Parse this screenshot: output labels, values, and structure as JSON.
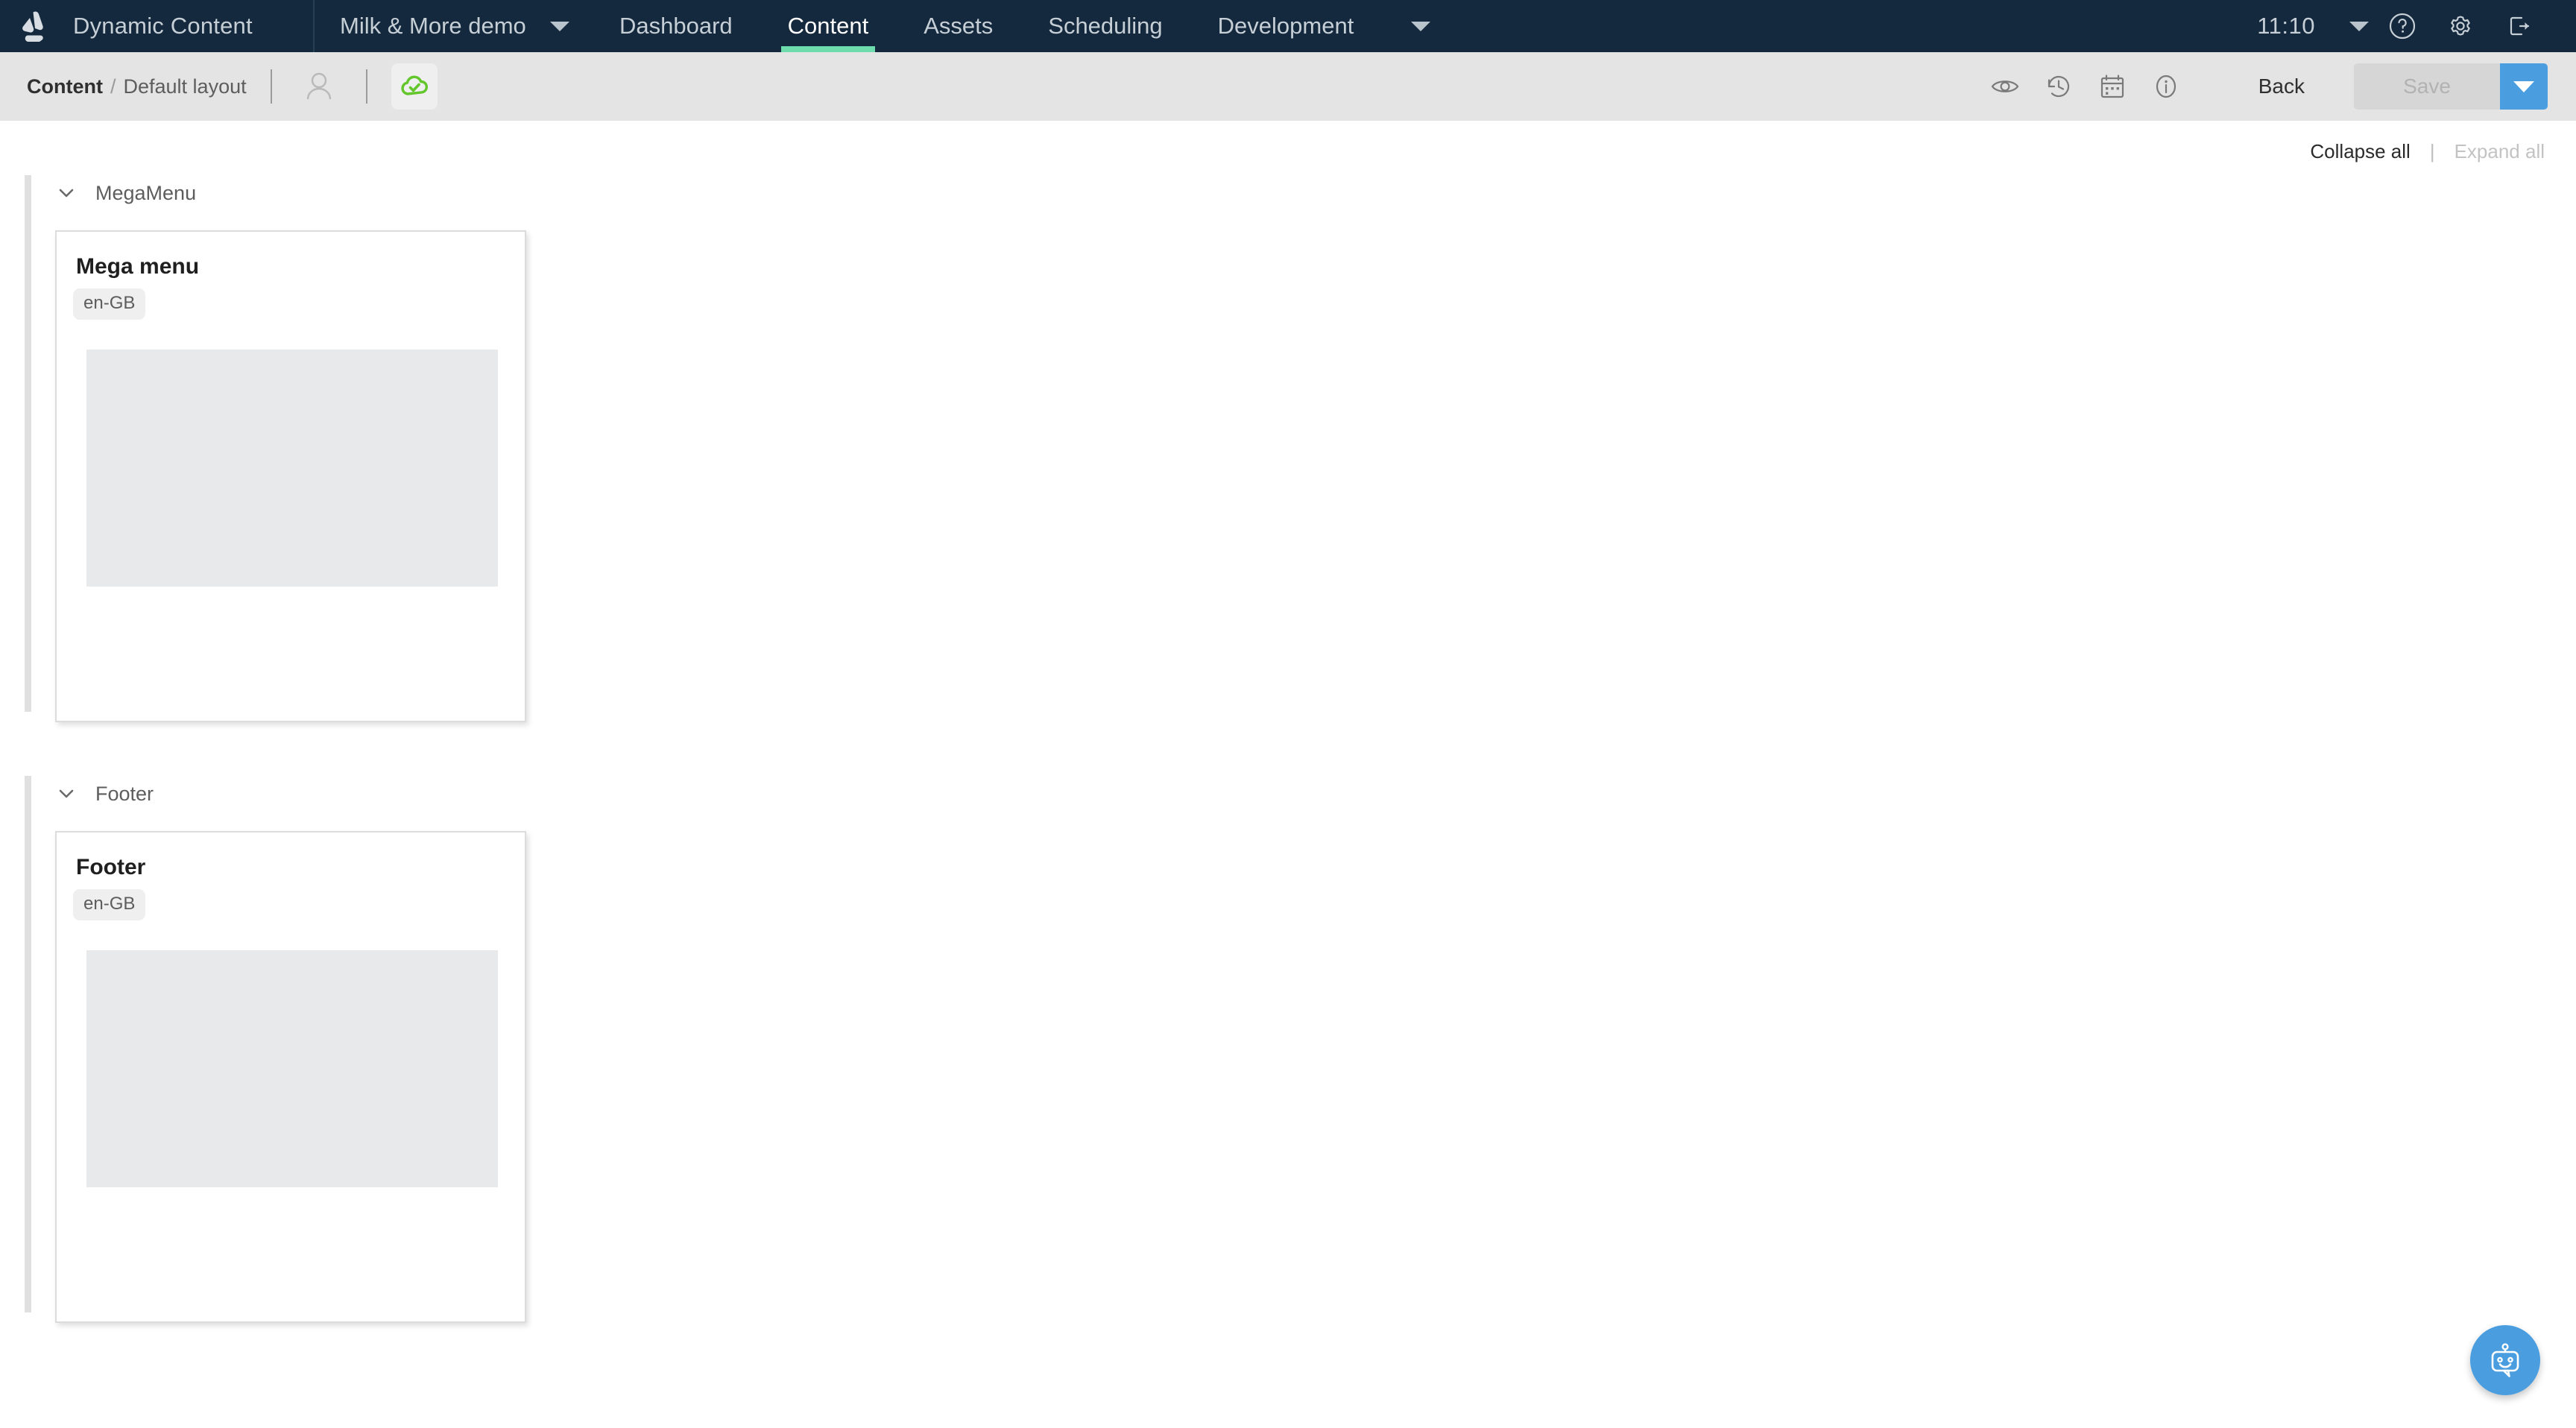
{
  "top_nav": {
    "logo_icon": "amplience-logo-icon",
    "product_title": "Dynamic Content",
    "hub_name": "Milk & More demo",
    "hub_caret_icon": "chevron-down-icon",
    "tabs": [
      {
        "label": "Dashboard",
        "active": false
      },
      {
        "label": "Content",
        "active": true
      },
      {
        "label": "Assets",
        "active": false
      },
      {
        "label": "Scheduling",
        "active": false
      },
      {
        "label": "Development",
        "active": false
      }
    ],
    "more_caret_icon": "chevron-down-icon",
    "clock": "11:10",
    "clock_caret_icon": "chevron-down-icon",
    "help_icon": "help-circle-icon",
    "settings_icon": "gear-icon",
    "logout_icon": "logout-icon",
    "accent_color": "#6fdcae",
    "background_color": "#14293d"
  },
  "sub_toolbar": {
    "breadcrumb_root": "Content",
    "breadcrumb_separator": "/",
    "breadcrumb_current": "Default layout",
    "user_icon": "user-icon",
    "publish_status_icon": "cloud-check-icon",
    "publish_status_color": "#63c62b",
    "preview_icon": "eye-icon",
    "history_icon": "history-clock-icon",
    "schedule_icon": "calendar-icon",
    "info_icon": "info-circle-icon",
    "back_label": "Back",
    "save_label": "Save",
    "save_enabled": false,
    "save_dropdown_icon": "chevron-down-icon",
    "save_dropdown_color": "#4a9ee0"
  },
  "main": {
    "collapse_all_label": "Collapse all",
    "collapse_separator": "|",
    "expand_all_label": "Expand all",
    "expand_all_enabled": false,
    "slots": [
      {
        "name": "MegaMenu",
        "chevron_icon": "chevron-down-icon",
        "card": {
          "title": "Mega menu",
          "locale": "en-GB",
          "thumbnail": "image-placeholder"
        }
      },
      {
        "name": "Footer",
        "chevron_icon": "chevron-down-icon",
        "card": {
          "title": "Footer",
          "locale": "en-GB",
          "thumbnail": "image-placeholder"
        }
      }
    ]
  },
  "chat_fab": {
    "icon": "chat-bot-icon",
    "color": "#4a9ee0"
  }
}
